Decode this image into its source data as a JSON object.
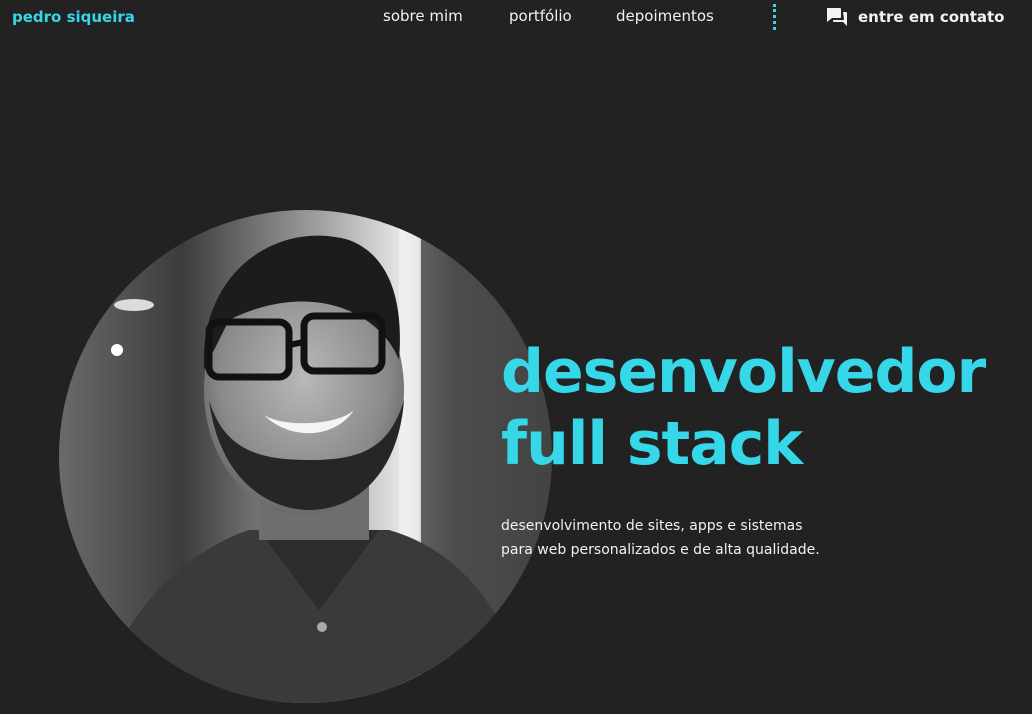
{
  "header": {
    "brand": "pedro siqueira",
    "nav": [
      "sobre mim",
      "portfólio",
      "depoimentos"
    ],
    "contact_label": "entre em contato",
    "contact_icon": "chat-bubbles-icon"
  },
  "hero": {
    "title_line1": "desenvolvedor",
    "title_line2": "full stack",
    "subtitle_line1": "desenvolvimento de sites, apps e sistemas",
    "subtitle_line2": "para web personalizados e de alta qualidade."
  },
  "colors": {
    "background": "#222222",
    "accent": "#35d7e8",
    "text": "#f2f2f2"
  }
}
